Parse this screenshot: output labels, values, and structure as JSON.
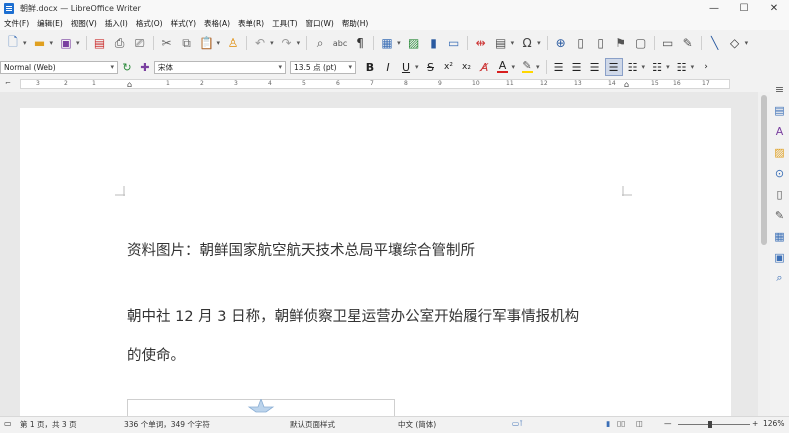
{
  "window": {
    "title": "朝鲜.docx — LibreOffice Writer",
    "minimize": "—",
    "maximize": "☐",
    "close": "✕"
  },
  "menu": [
    "文件(F)",
    "编辑(E)",
    "视图(V)",
    "插入(I)",
    "格式(O)",
    "样式(Y)",
    "表格(A)",
    "表单(R)",
    "工具(T)",
    "窗口(W)",
    "帮助(H)"
  ],
  "format_toolbar": {
    "paragraph_style": "Normal (Web)",
    "font_name": "宋体",
    "font_size": "13.5 点 (pt)",
    "bold": "B",
    "italic": "I",
    "underline": "U",
    "strike": "S",
    "superscript": "x²",
    "subscript": "x₂",
    "font_color_glyph": "A"
  },
  "ruler_numbers": [
    "3",
    "2",
    "1",
    "1",
    "2",
    "3",
    "4",
    "5",
    "6",
    "7",
    "8",
    "9",
    "10",
    "11",
    "12",
    "13",
    "14",
    "15",
    "16",
    "17"
  ],
  "document": {
    "caption": "资料图片：朝鲜国家航空航天技术总局平壤综合管制所",
    "para1_line1": "朝中社 12 月 3 日称，朝鲜侦察卫星运营办公室开始履行军事情报机构",
    "para1_line2": "的使命。"
  },
  "status": {
    "page": "第 1 页，共 3 页",
    "words": "336 个单词，349 个字符",
    "page_style": "默认页面样式",
    "language": "中文 (简体)",
    "zoom": "126%",
    "zoom_minus": "—",
    "zoom_plus": "+"
  },
  "colors": {
    "accent": "#3b6fb6",
    "font_color_bar": "#d81e1e",
    "highlight_bar": "#ffd700"
  }
}
